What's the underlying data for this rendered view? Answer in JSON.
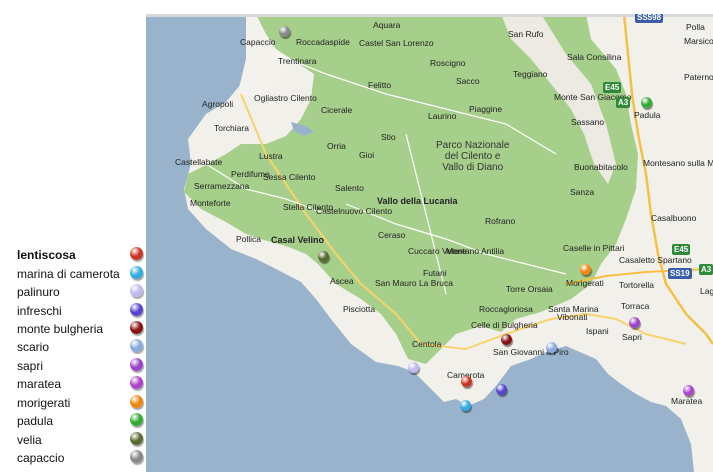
{
  "legend": [
    {
      "label": "lentiscosa",
      "color": "#cc3322",
      "bold": true
    },
    {
      "label": "marina di camerota",
      "color": "#33aadd",
      "bold": false
    },
    {
      "label": "palinuro",
      "color": "#bbbbee",
      "bold": false
    },
    {
      "label": "infreschi",
      "color": "#5544cc",
      "bold": false
    },
    {
      "label": "monte bulgheria",
      "color": "#881111",
      "bold": false
    },
    {
      "label": "scario",
      "color": "#88aadd",
      "bold": false
    },
    {
      "label": "sapri",
      "color": "#9944cc",
      "bold": false
    },
    {
      "label": "maratea",
      "color": "#aa44cc",
      "bold": false
    },
    {
      "label": "morigerati",
      "color": "#ee8811",
      "bold": false
    },
    {
      "label": "padula",
      "color": "#33aa33",
      "bold": false
    },
    {
      "label": "velia",
      "color": "#556b2f",
      "bold": false
    },
    {
      "label": "capaccio",
      "color": "#888888",
      "bold": false
    }
  ],
  "map": {
    "park_label": [
      "Parco Nazionale",
      "del Cilento e",
      "Vallo di Diano"
    ],
    "places": [
      "Aquara",
      "Capaccio",
      "Roccadaspide",
      "Castel San Lorenzo",
      "San Rufo",
      "Trentinara",
      "Felitto",
      "Roscigno",
      "Teggiano",
      "Sala Consilina",
      "Monte San Giacomo",
      "Sassano",
      "Padula",
      "Agropoli",
      "Ogliastro Cilento",
      "Cicerale",
      "Sacco",
      "Piaggine",
      "Laurino",
      "Torchiara",
      "Stio",
      "Orria",
      "Gioi",
      "Castellabate",
      "Lustra",
      "Perdifumo",
      "Sessa Cilento",
      "Serramezzana",
      "Salento",
      "Vallo della Lucania",
      "Buonabitacolo",
      "Montesano sulla Marcellana",
      "Monteforte",
      "Stella Cilento",
      "Castelnuovo Cilento",
      "Sanza",
      "Casalbuono",
      "Pollica",
      "Casal Velino",
      "Ceraso",
      "Rofrano",
      "Caselle in Pittari",
      "Casaletto Spartano",
      "Morigerati",
      "Tortorella",
      "Cuccaro Vetere",
      "Montano Antilia",
      "Futani",
      "Ascea",
      "San Mauro La Bruca",
      "Torre Orsaia",
      "Roccagloriosa",
      "Santa Marina",
      "Torraca",
      "Pisciotta",
      "Vibonati",
      "Ispani",
      "Sapri",
      "Celle di Bulgheria",
      "Centola",
      "San Giovanni a Piro",
      "Camerota",
      "Maratea",
      "Lago",
      "Polla",
      "Marsico Nuovo",
      "Paterno"
    ],
    "shields": [
      "SS598",
      "E45",
      "A3",
      "E45",
      "SS19",
      "A3"
    ]
  }
}
